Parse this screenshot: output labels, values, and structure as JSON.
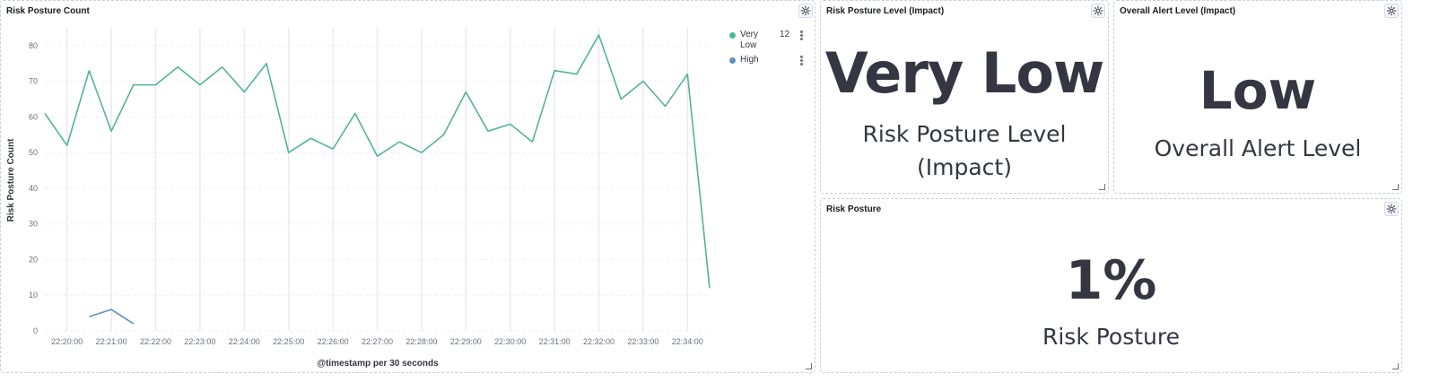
{
  "panels": {
    "risk_count": {
      "title": "Risk Posture Count",
      "legend": [
        {
          "label_line1": "Very",
          "label_line2": "Low",
          "value": "12",
          "color": "#54b399"
        },
        {
          "label_line1": "High",
          "label_line2": "",
          "value": "",
          "color": "#6092c0"
        }
      ]
    },
    "risk_level": {
      "title": "Risk Posture Level (Impact)",
      "value": "Very Low",
      "label_line1": "Risk Posture Level",
      "label_line2": "(Impact)"
    },
    "alert_level": {
      "title": "Overall Alert Level (Impact)",
      "value": "Low",
      "label": "Overall Alert Level"
    },
    "risk_posture": {
      "title": "Risk Posture",
      "value": "1%",
      "label": "Risk Posture"
    }
  },
  "chart_data": {
    "type": "line",
    "title": "Risk Posture Count",
    "xlabel": "@timestamp per 30 seconds",
    "ylabel": "Risk Posture Count",
    "ylim": [
      0,
      85
    ],
    "yticks": [
      "0",
      "10",
      "20",
      "30",
      "40",
      "50",
      "60",
      "70",
      "80"
    ],
    "xticks": [
      "22:20:00",
      "22:21:00",
      "22:22:00",
      "22:23:00",
      "22:24:00",
      "22:25:00",
      "22:26:00",
      "22:27:00",
      "22:28:00",
      "22:29:00",
      "22:30:00",
      "22:31:00",
      "22:32:00",
      "22:33:00",
      "22:34:00"
    ],
    "x_start": "22:19:30",
    "x_step_seconds": 30,
    "series": [
      {
        "name": "Very Low",
        "color": "#54b399",
        "start_index": 0,
        "values": [
          61,
          52,
          73,
          56,
          69,
          69,
          74,
          69,
          74,
          67,
          75,
          50,
          54,
          51,
          61,
          49,
          53,
          50,
          55,
          67,
          56,
          58,
          53,
          73,
          72,
          83,
          65,
          70,
          63,
          72,
          12
        ]
      },
      {
        "name": "High",
        "color": "#6092c0",
        "start_index": 2,
        "values": [
          4,
          6,
          2
        ]
      }
    ],
    "grid": true,
    "legend": "top-right"
  }
}
